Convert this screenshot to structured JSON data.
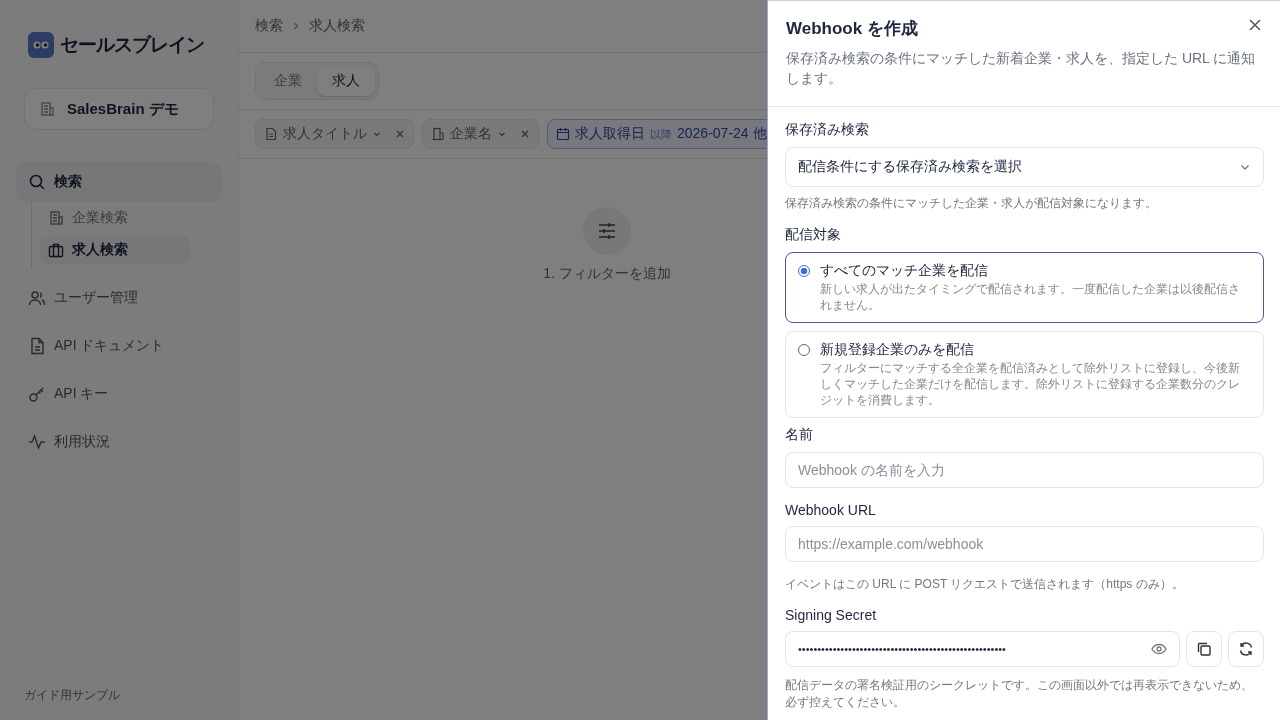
{
  "sidebar": {
    "logo": "セールスブレイン",
    "workspace": "SalesBrain デモ",
    "nav": [
      {
        "label": "検索",
        "selected": true,
        "expanded": true,
        "children": [
          {
            "label": "企業検索",
            "selected": false
          },
          {
            "label": "求人検索",
            "selected": true
          }
        ]
      },
      {
        "label": "ユーザー管理",
        "selected": false
      },
      {
        "label": "API ドキュメント",
        "selected": false
      },
      {
        "label": "API キー",
        "selected": false
      },
      {
        "label": "利用状況",
        "selected": false
      }
    ],
    "footer": "ガイド用サンプル"
  },
  "breadcrumb": [
    "検索",
    "求人検索"
  ],
  "tabs": [
    {
      "label": "企業",
      "selected": false
    },
    {
      "label": "求人",
      "selected": true
    }
  ],
  "filters": [
    {
      "label": "求人タイトル",
      "active": false
    },
    {
      "label": "企業名",
      "active": false
    },
    {
      "label": "求人取得日",
      "active": true,
      "qualifier": "以降",
      "value": "2026-07-24 他"
    }
  ],
  "empty_state": "1. フィルターを追加",
  "dialog": {
    "title": "Webhook を作成",
    "description": "保存済み検索の条件にマッチした新着企業・求人を、指定した URL に通知します。",
    "saved_search": {
      "label": "保存済み検索",
      "value": "配信条件にする保存済み検索を選択",
      "help": "保存済み検索の条件にマッチした企業・求人が配信対象になります。"
    },
    "target": {
      "label": "配信対象",
      "options": [
        {
          "title": "すべてのマッチ企業を配信",
          "description": "新しい求人が出たタイミングで配信されます。一度配信した企業は以後配信されません。",
          "selected": true
        },
        {
          "title": "新規登録企業のみを配信",
          "description": "フィルターにマッチする全企業を配信済みとして除外リストに登録し、今後新しくマッチした企業だけを配信します。除外リストに登録する企業数分のクレジットを消費します。",
          "selected": false
        }
      ]
    },
    "name": {
      "label": "名前",
      "placeholder": "Webhook の名前を入力"
    },
    "url": {
      "label": "Webhook URL",
      "placeholder": "https://example.com/webhook",
      "help": "イベントはこの URL に POST リクエストで送信されます（https のみ）。"
    },
    "secret": {
      "label": "Signing Secret",
      "value": "••••••••••••••••••••••••••••••••••••••••••••••••••••••",
      "help": "配信データの署名検証用のシークレットです。この画面以外では再表示できないため、必ず控えてください。"
    }
  }
}
